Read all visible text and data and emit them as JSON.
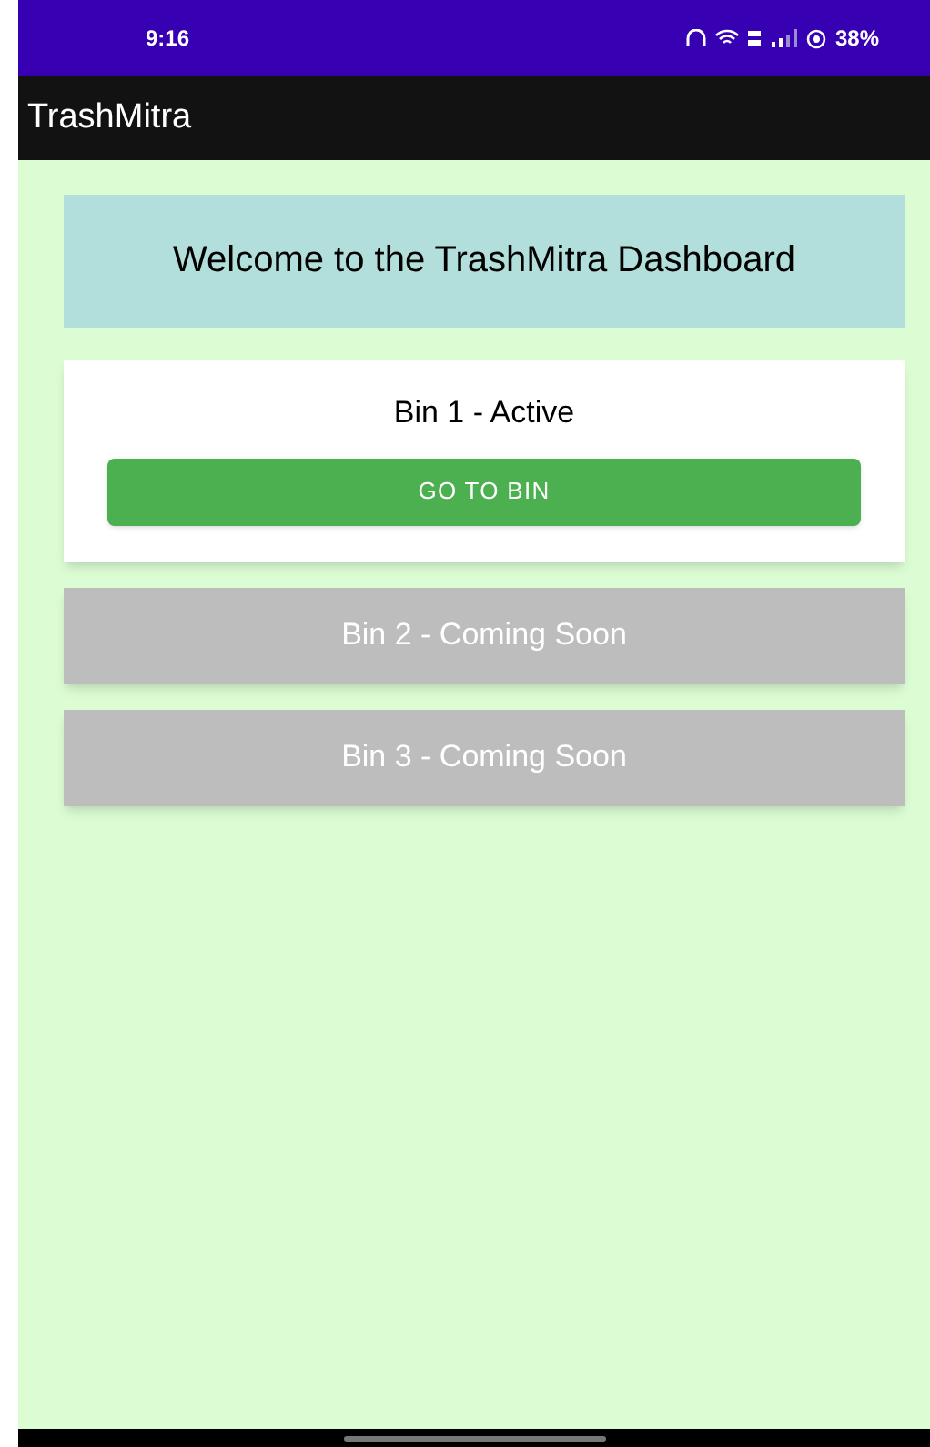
{
  "status_bar": {
    "time": "9:16",
    "battery": "38%"
  },
  "app_bar": {
    "title": "TrashMitra"
  },
  "welcome": {
    "text": "Welcome to the TrashMitra Dashboard"
  },
  "bins": [
    {
      "kind": "active",
      "label": "Bin 1 - Active",
      "button": "GO TO BIN"
    },
    {
      "kind": "coming_soon",
      "label": "Bin 2 - Coming Soon"
    },
    {
      "kind": "coming_soon",
      "label": "Bin 3 - Coming Soon"
    }
  ]
}
